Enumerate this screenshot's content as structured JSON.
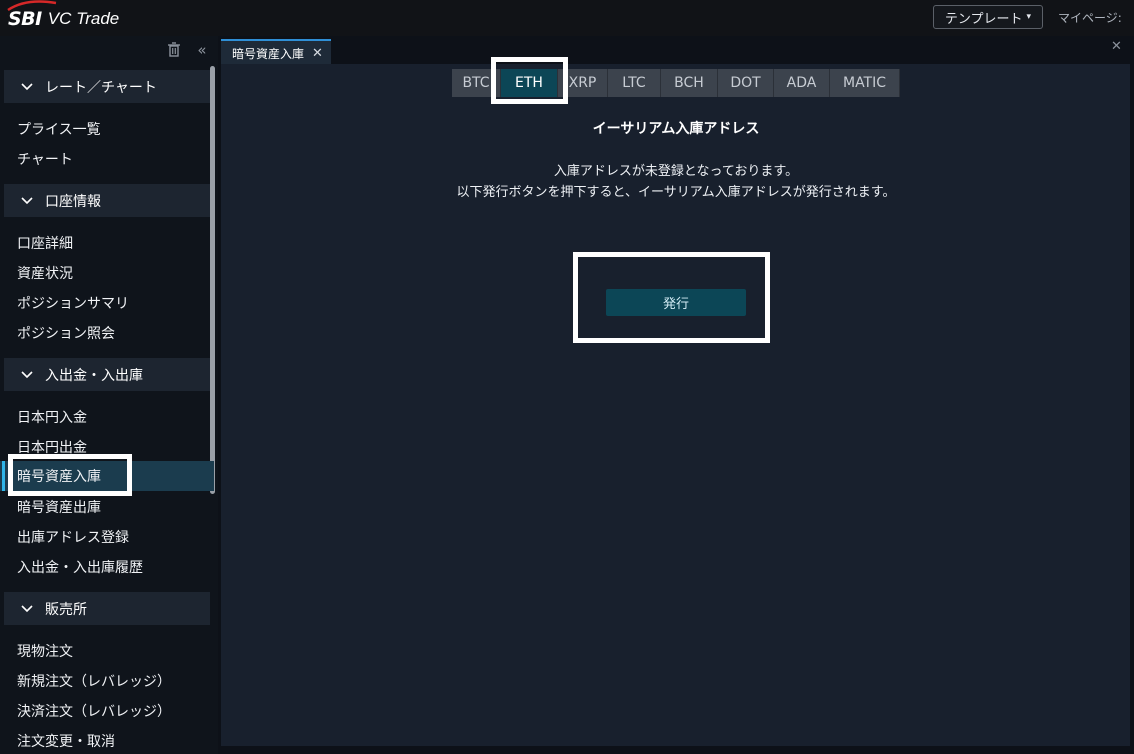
{
  "header": {
    "logo_brand": "SBI",
    "logo_text": "VC Trade",
    "template_button": "テンプレート",
    "mypage_label": "マイページ:"
  },
  "sidebar": {
    "sections": [
      {
        "label": "レート／チャート",
        "items": [
          "プライス一覧",
          "チャート"
        ]
      },
      {
        "label": "口座情報",
        "items": [
          "口座詳細",
          "資産状況",
          "ポジションサマリ",
          "ポジション照会"
        ]
      },
      {
        "label": "入出金・入出庫",
        "items": [
          "日本円入金",
          "日本円出金",
          "暗号資産入庫",
          "暗号資産出庫",
          "出庫アドレス登録",
          "入出金・入出庫履歴"
        ]
      },
      {
        "label": "販売所",
        "items": [
          "現物注文",
          "新規注文（レバレッジ）",
          "決済注文（レバレッジ）",
          "注文変更・取消"
        ]
      }
    ],
    "active_item": "暗号資産入庫"
  },
  "main": {
    "tab_label": "暗号資産入庫",
    "coins": [
      "BTC",
      "ETH",
      "XRP",
      "LTC",
      "BCH",
      "DOT",
      "ADA",
      "MATIC"
    ],
    "selected_coin": "ETH",
    "title": "イーサリアム入庫アドレス",
    "message_line1": "入庫アドレスが未登録となっております。",
    "message_line2": "以下発行ボタンを押下すると、イーサリアム入庫アドレスが発行されます。",
    "issue_button": "発行"
  },
  "colors": {
    "accent": "#2fb4e8",
    "selected_bg": "#0c4656",
    "panel_bg": "#18202d",
    "sidebar_bg": "#0f141b"
  }
}
